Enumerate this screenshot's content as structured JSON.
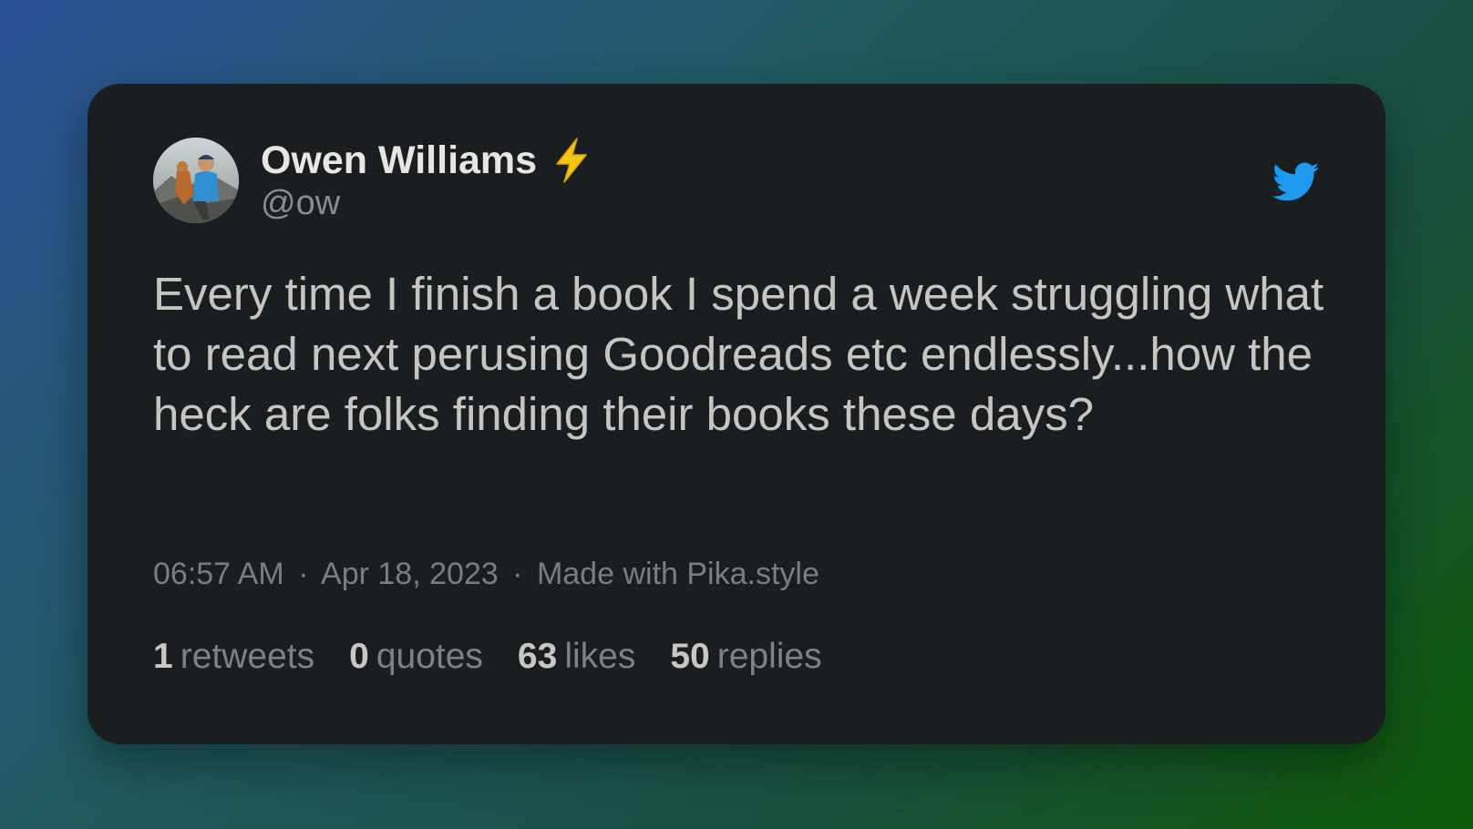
{
  "tweet": {
    "author": {
      "display_name": "Owen Williams",
      "handle": "@ow",
      "badge_icon": "lightning-bolt-icon"
    },
    "brand_icon": "twitter-bird-icon",
    "brand_color": "#1d9bf0",
    "text": "Every time I finish a book I spend a week struggling what to read next perusing Goodreads etc endlessly...how the heck are folks finding their books these days?",
    "time": "06:57 AM",
    "date": "Apr 18, 2023",
    "separator": "·",
    "made_with": "Made with Pika.style",
    "stats": [
      {
        "count": "1",
        "label": "retweets"
      },
      {
        "count": "0",
        "label": "quotes"
      },
      {
        "count": "63",
        "label": "likes"
      },
      {
        "count": "50",
        "label": "replies"
      }
    ]
  }
}
